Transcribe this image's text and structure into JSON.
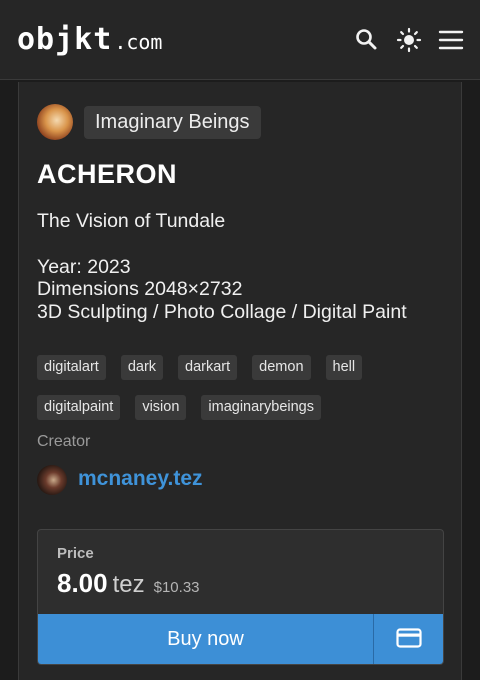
{
  "header": {
    "logo_main": "objkt",
    "logo_tld": ".com",
    "icons": [
      "search-icon",
      "sun-icon",
      "menu-icon"
    ]
  },
  "collection": {
    "name": "Imaginary Beings"
  },
  "artwork": {
    "title": "ACHERON",
    "description_lines": [
      "The Vision of Tundale",
      "",
      "Year: 2023",
      "Dimensions 2048×2732",
      "3D Sculpting / Photo Collage / Digital Paint"
    ],
    "tags": [
      "digitalart",
      "dark",
      "darkart",
      "demon",
      "hell",
      "digitalpaint",
      "vision",
      "imaginarybeings"
    ]
  },
  "creator": {
    "label": "Creator",
    "name": "mcnaney.tez"
  },
  "listing": {
    "price_label": "Price",
    "amount": "8.00",
    "unit": "tez",
    "usd": "$10.33",
    "buy_label": "Buy now",
    "card_icon": "credit-card-icon"
  },
  "colors": {
    "accent": "#3d8fd6",
    "link": "#3f93d9",
    "background": "#1c1c1c"
  }
}
